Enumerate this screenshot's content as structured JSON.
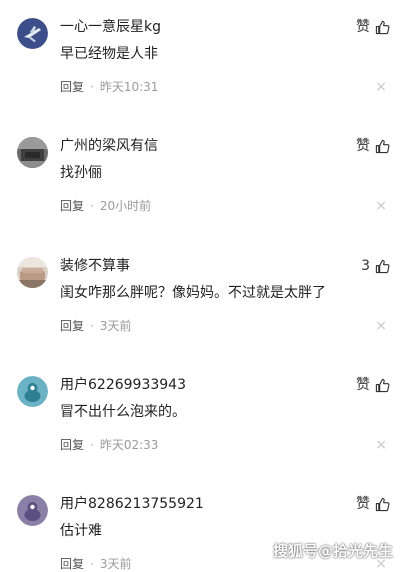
{
  "comments": [
    {
      "user": "一心一意辰星kg",
      "text": "早已经物是人非",
      "reply": "回复",
      "separator": "·",
      "time": "昨天10:31",
      "likes": "赞",
      "close": "×",
      "avatar_icon": "jet-airplane-avatar"
    },
    {
      "user": "广州的梁风有信",
      "text": "找孙俪",
      "reply": "回复",
      "separator": "·",
      "time": "20小时前",
      "likes": "赞",
      "close": "×",
      "avatar_icon": "room-photo-avatar"
    },
    {
      "user": "装修不算事",
      "text": "闺女咋那么胖呢？像妈妈。不过就是太胖了",
      "reply": "回复",
      "separator": "·",
      "time": "3天前",
      "likes": "3",
      "close": "×",
      "avatar_icon": "living-room-avatar"
    },
    {
      "user": "用户62269933943",
      "text": "冒不出什么泡来的。",
      "reply": "回复",
      "separator": "·",
      "time": "昨天02:33",
      "likes": "赞",
      "close": "×",
      "avatar_icon": "default-user-avatar-teal"
    },
    {
      "user": "用户8286213755921",
      "text": "估计难",
      "reply": "回复",
      "separator": "·",
      "time": "3天前",
      "likes": "赞",
      "close": "×",
      "avatar_icon": "default-user-avatar-purple"
    }
  ],
  "watermark": "搜狐号@拾光先生",
  "colors": {
    "avatar1_bg": "#3d4f8a",
    "avatar4_bg": "#6ab2c4",
    "avatar5_bg": "#8a7fa6",
    "time_text": "#9a9a9a"
  }
}
